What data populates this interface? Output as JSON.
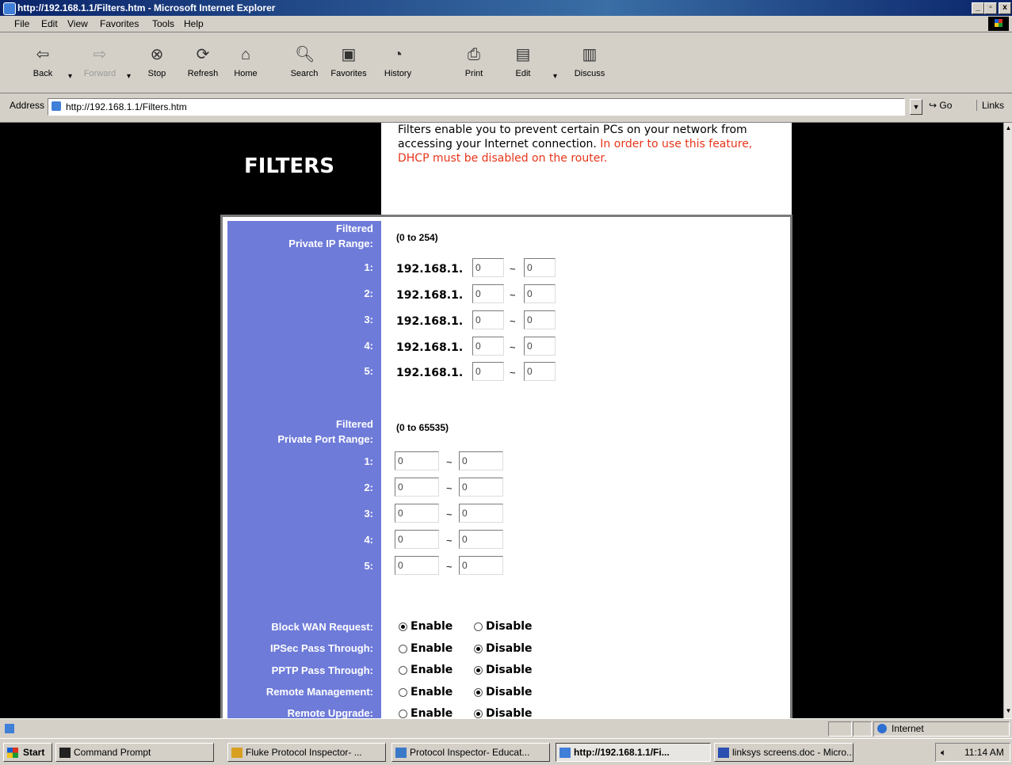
{
  "window": {
    "title": "http://192.168.1.1/Filters.htm - Microsoft Internet Explorer",
    "controls": [
      "_",
      "▫",
      "x"
    ]
  },
  "menu": [
    "File",
    "Edit",
    "View",
    "Favorites",
    "Tools",
    "Help"
  ],
  "toolbar": {
    "back": "Back",
    "forward": "Forward",
    "stop": "Stop",
    "refresh": "Refresh",
    "home": "Home",
    "search": "Search",
    "favorites": "Favorites",
    "history": "History",
    "print": "Print",
    "edit": "Edit",
    "discuss": "Discuss"
  },
  "address": {
    "label": "Address",
    "url": "http://192.168.1.1/Filters.htm",
    "go": "Go",
    "links": "Links"
  },
  "page": {
    "title": "FILTERS",
    "description": "Filters enable you to prevent certain PCs on your network from accessing your Internet connection.",
    "warning": "In order to use this feature, DHCP must be disabled on the router.",
    "ip_section": {
      "label_line1": "Filtered",
      "label_line2": "Private IP Range:",
      "range_hint": "(0 to 254)",
      "prefix": "192.168.1.",
      "rows": [
        {
          "num": "1:",
          "from": "0",
          "to": "0"
        },
        {
          "num": "2:",
          "from": "0",
          "to": "0"
        },
        {
          "num": "3:",
          "from": "0",
          "to": "0"
        },
        {
          "num": "4:",
          "from": "0",
          "to": "0"
        },
        {
          "num": "5:",
          "from": "0",
          "to": "0"
        }
      ]
    },
    "port_section": {
      "label_line1": "Filtered",
      "label_line2": "Private Port Range:",
      "range_hint": "(0 to 65535)",
      "rows": [
        {
          "num": "1:",
          "from": "0",
          "to": "0"
        },
        {
          "num": "2:",
          "from": "0",
          "to": "0"
        },
        {
          "num": "3:",
          "from": "0",
          "to": "0"
        },
        {
          "num": "4:",
          "from": "0",
          "to": "0"
        },
        {
          "num": "5:",
          "from": "0",
          "to": "0"
        }
      ]
    },
    "options": [
      {
        "label": "Block WAN Request:",
        "enable": "Enable",
        "disable": "Disable",
        "selected": "enable"
      },
      {
        "label": "IPSec Pass Through:",
        "enable": "Enable",
        "disable": "Disable",
        "selected": "disable"
      },
      {
        "label": "PPTP Pass Through:",
        "enable": "Enable",
        "disable": "Disable",
        "selected": "disable"
      },
      {
        "label": "Remote Management:",
        "enable": "Enable",
        "disable": "Disable",
        "selected": "disable"
      },
      {
        "label": "Remote Upgrade:",
        "enable": "Enable",
        "disable": "Disable",
        "selected": "disable"
      }
    ]
  },
  "statusbar": {
    "zone": "Internet"
  },
  "taskbar": {
    "start": "Start",
    "tasks": [
      "Command Prompt",
      "Fluke Protocol Inspector- ...",
      "Protocol Inspector- Educat...",
      "http://192.168.1.1/Fi...",
      "linksys screens.doc - Micro..."
    ],
    "clock": "11:14 AM"
  }
}
